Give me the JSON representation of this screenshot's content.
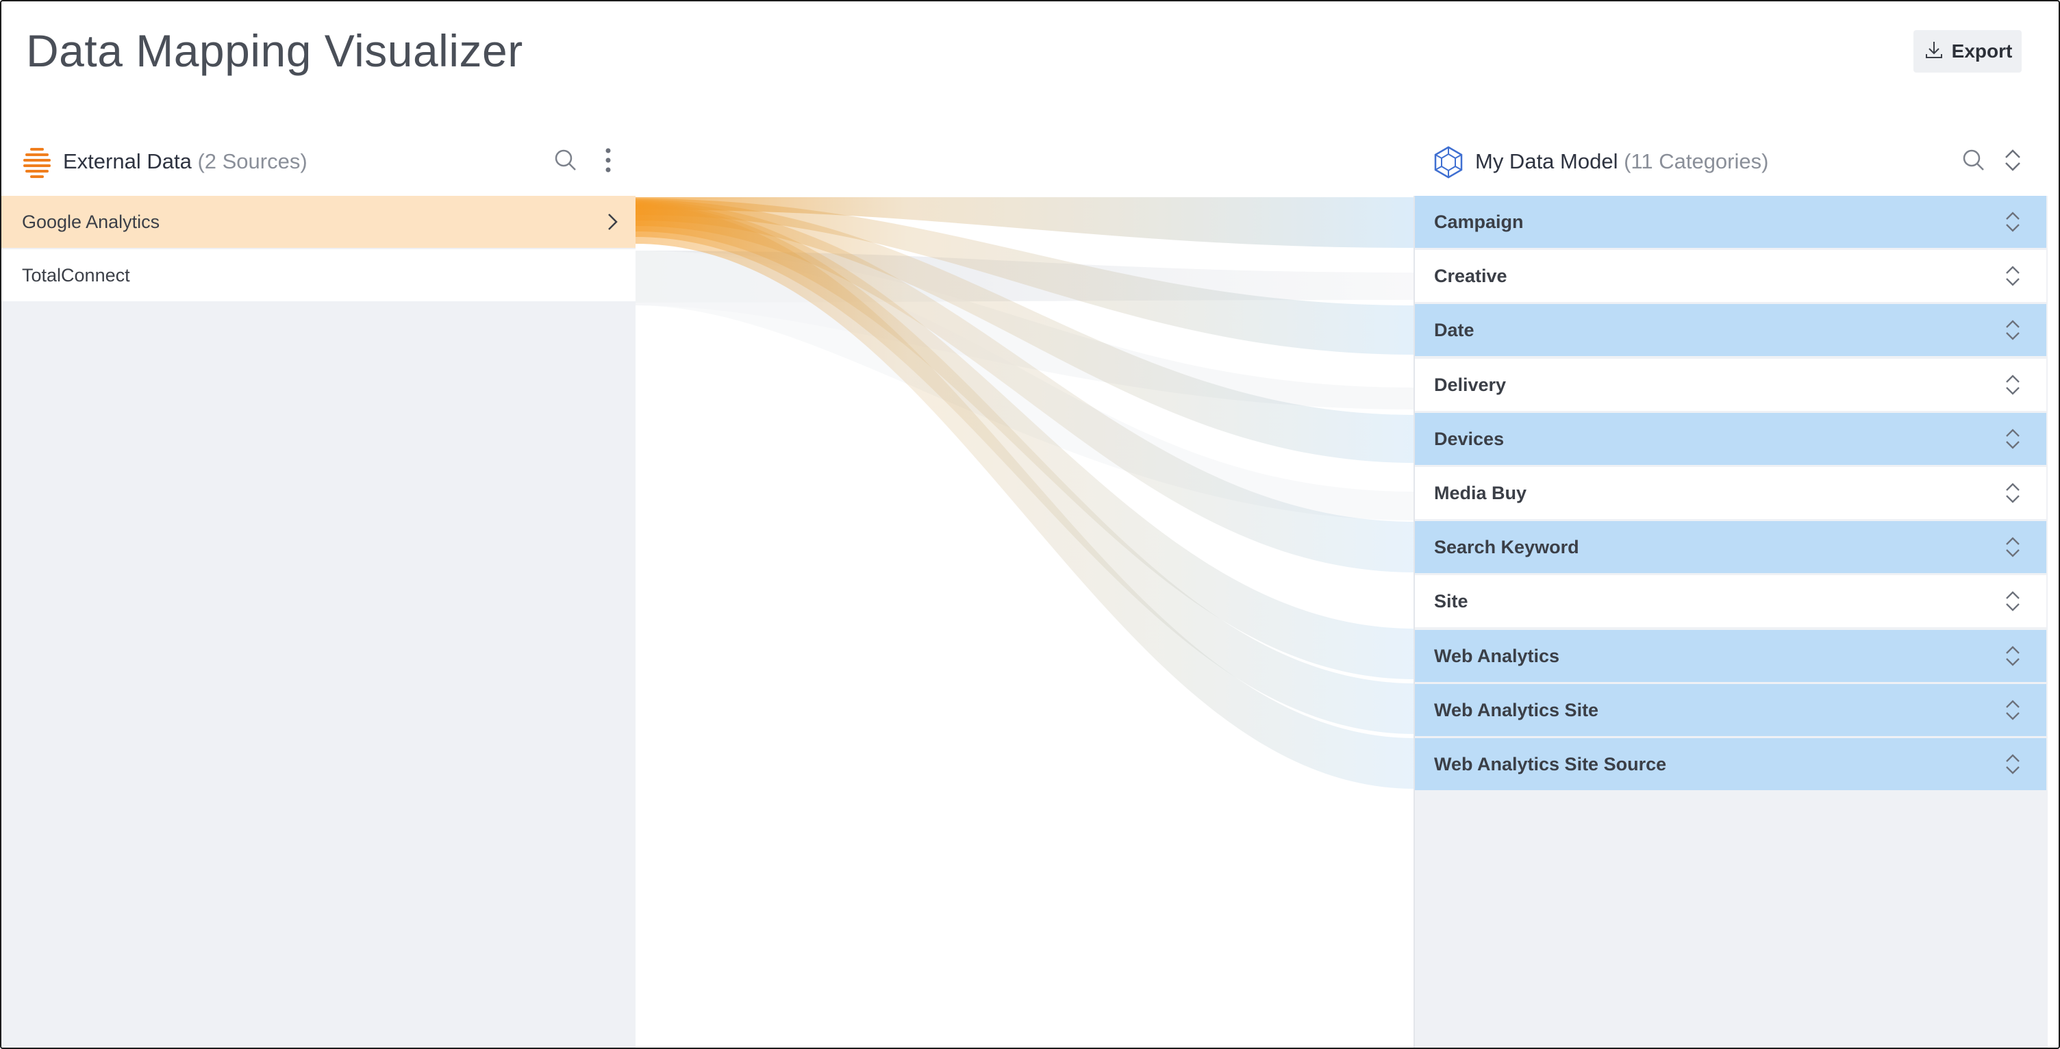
{
  "app": {
    "title": "Data Mapping Visualizer"
  },
  "toolbar": {
    "export_label": "Export"
  },
  "external": {
    "title": "External Data",
    "count": "(2 Sources)",
    "sources": [
      {
        "label": "Google Analytics",
        "selected": true
      },
      {
        "label": "TotalConnect",
        "selected": false
      }
    ]
  },
  "model": {
    "title": "My Data Model",
    "count": "(11 Categories)",
    "categories": [
      {
        "label": "Campaign",
        "mapped": true
      },
      {
        "label": "Creative",
        "mapped": false
      },
      {
        "label": "Date",
        "mapped": true
      },
      {
        "label": "Delivery",
        "mapped": false
      },
      {
        "label": "Devices",
        "mapped": true
      },
      {
        "label": "Media Buy",
        "mapped": false
      },
      {
        "label": "Search Keyword",
        "mapped": true
      },
      {
        "label": "Site",
        "mapped": false
      },
      {
        "label": "Web Analytics",
        "mapped": true
      },
      {
        "label": "Web Analytics Site",
        "mapped": true
      },
      {
        "label": "Web Analytics Site Source",
        "mapped": true
      }
    ]
  },
  "colors": {
    "source_active": "#f59a23",
    "source_active_row": "#fde3c3",
    "mapped_row": "#bcdcf7",
    "flow_end": "#bcdcf7"
  }
}
